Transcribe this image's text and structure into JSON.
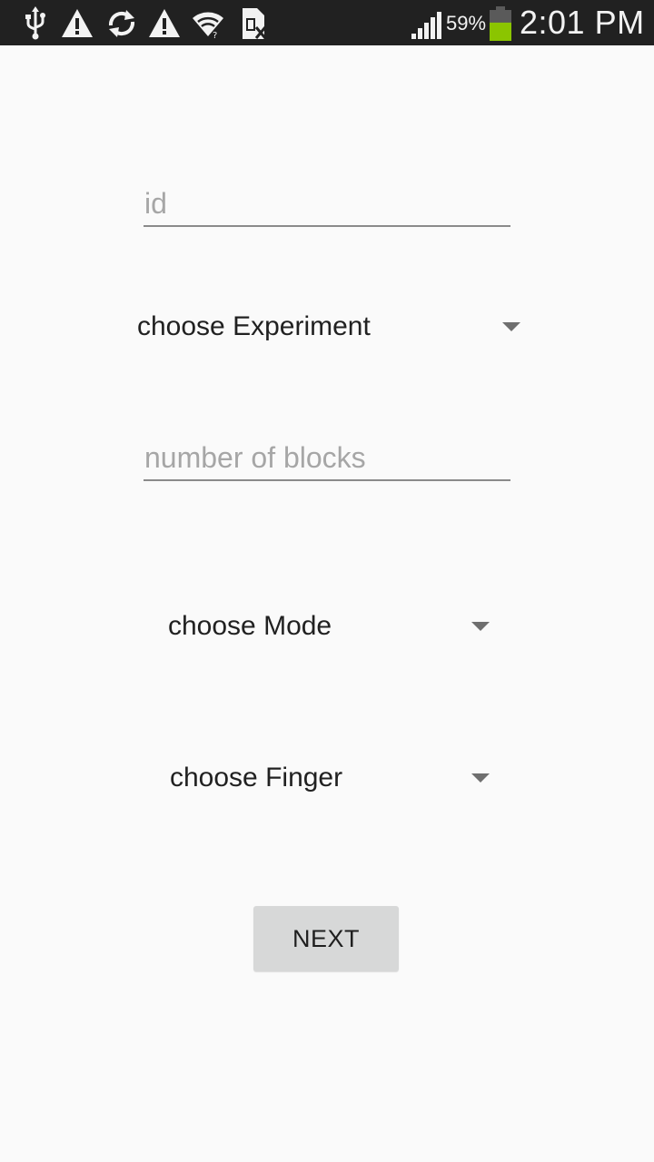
{
  "status_bar": {
    "icons": [
      "usb-icon",
      "warning-icon",
      "sync-icon",
      "warning-icon",
      "wifi-icon",
      "no-sim-icon",
      "signal-icon",
      "battery-icon"
    ],
    "battery_percent": "59%",
    "time": "2:01 PM",
    "battery_color": "#8bc500"
  },
  "form": {
    "id_field": {
      "placeholder": "id",
      "value": ""
    },
    "experiment_spinner": {
      "label": "choose Experiment"
    },
    "blocks_field": {
      "placeholder": "number of blocks",
      "value": ""
    },
    "mode_spinner": {
      "label": "choose Mode"
    },
    "finger_spinner": {
      "label": "choose Finger"
    },
    "next_button": {
      "label": "NEXT"
    }
  }
}
